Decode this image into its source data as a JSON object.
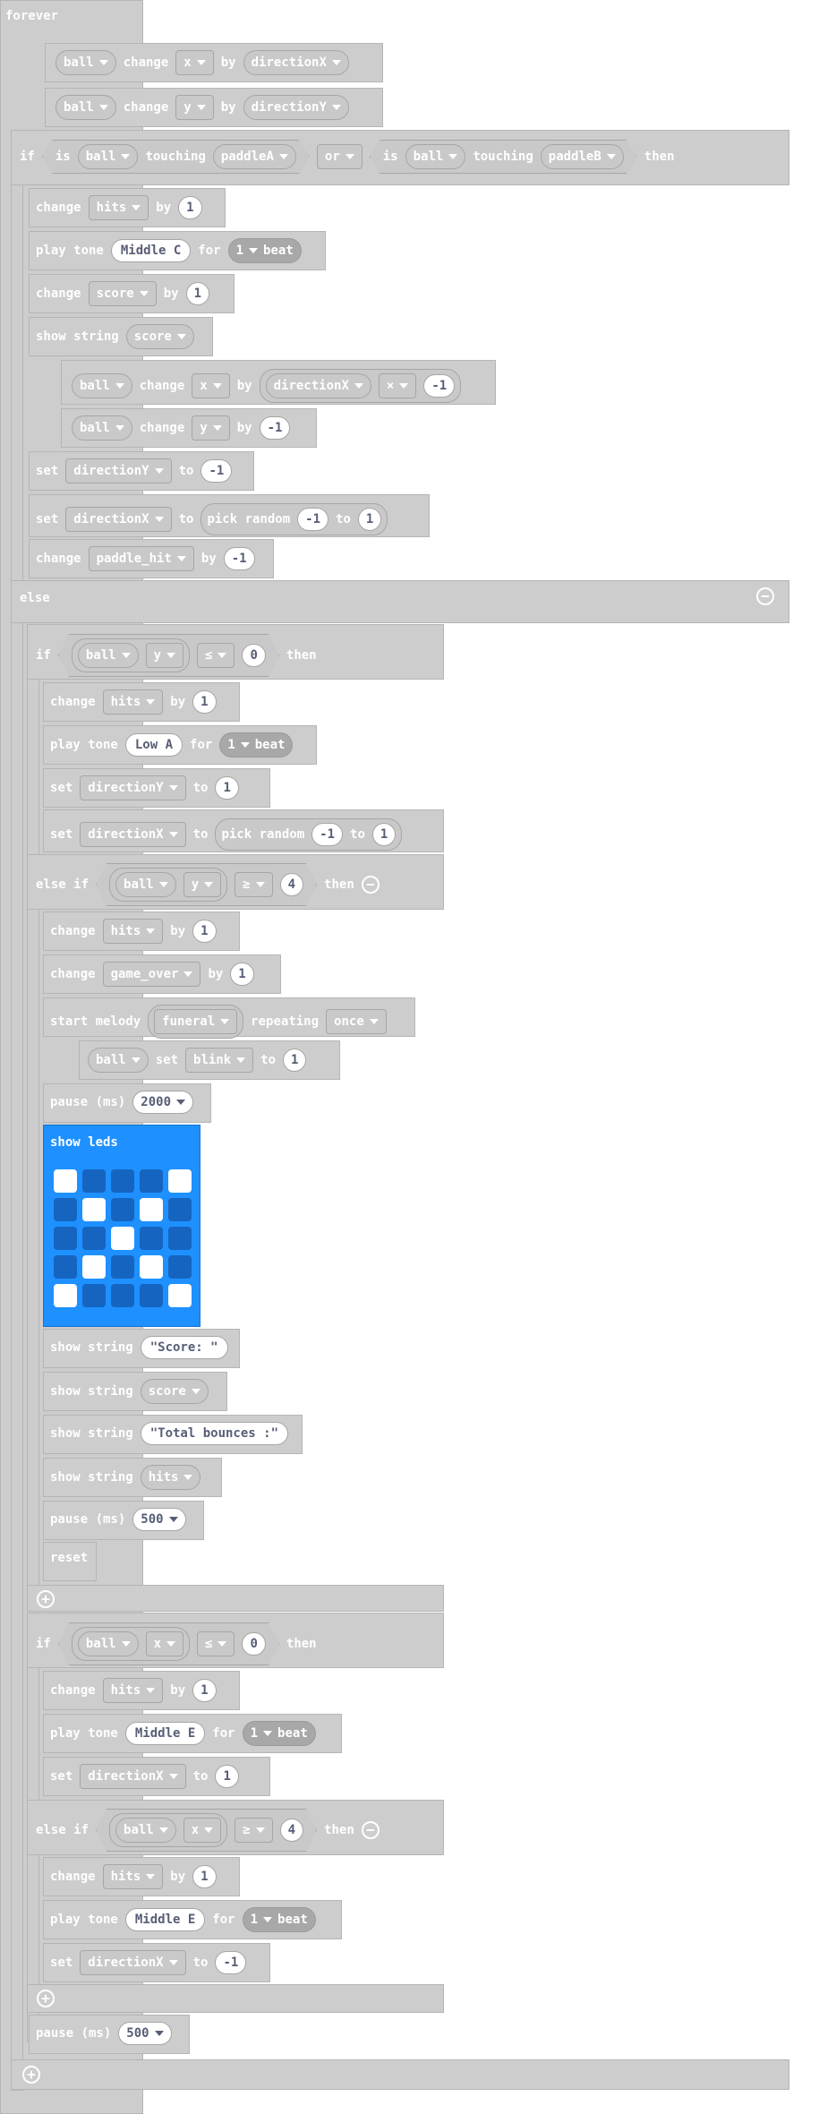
{
  "blocks": [
    {
      "w": "forever"
    },
    {
      "w": "ball"
    },
    {
      "w": "change"
    },
    {
      "w": "x"
    },
    {
      "w": "by"
    },
    {
      "w": "directionX"
    },
    {
      "w": "ball"
    },
    {
      "w": "change"
    },
    {
      "w": "y"
    },
    {
      "w": "by"
    },
    {
      "w": "directionY"
    },
    {
      "w": "if"
    },
    {
      "w": "is"
    },
    {
      "w": "ball"
    },
    {
      "w": "touching"
    },
    {
      "w": "paddleA"
    },
    {
      "w": "or"
    },
    {
      "w": "is"
    },
    {
      "w": "ball"
    },
    {
      "w": "touching"
    },
    {
      "w": "paddleB"
    },
    {
      "w": "then"
    },
    {
      "w": "change"
    },
    {
      "w": "hits"
    },
    {
      "w": "by"
    },
    {
      "w": "1"
    },
    {
      "w": "play tone"
    },
    {
      "w": "Middle C"
    },
    {
      "w": "for"
    },
    {
      "w": "1"
    },
    {
      "w": "beat"
    },
    {
      "w": "change"
    },
    {
      "w": "score"
    },
    {
      "w": "by"
    },
    {
      "w": "1"
    },
    {
      "w": "show string"
    },
    {
      "w": "score"
    },
    {
      "w": "ball"
    },
    {
      "w": "change"
    },
    {
      "w": "x"
    },
    {
      "w": "by"
    },
    {
      "w": "directionX"
    },
    {
      "w": "×"
    },
    {
      "w": "-1"
    },
    {
      "w": "ball"
    },
    {
      "w": "change"
    },
    {
      "w": "y"
    },
    {
      "w": "by"
    },
    {
      "w": "-1"
    },
    {
      "w": "set"
    },
    {
      "w": "directionY"
    },
    {
      "w": "to"
    },
    {
      "w": "-1"
    },
    {
      "w": "set"
    },
    {
      "w": "directionX"
    },
    {
      "w": "to"
    },
    {
      "w": "pick random"
    },
    {
      "w": "-1"
    },
    {
      "w": "to"
    },
    {
      "w": "1"
    },
    {
      "w": "change"
    },
    {
      "w": "paddle_hit"
    },
    {
      "w": "by"
    },
    {
      "w": "-1"
    },
    {
      "w": "else"
    },
    {
      "w": "if"
    },
    {
      "w": "ball"
    },
    {
      "w": "y"
    },
    {
      "w": "≤"
    },
    {
      "w": "0"
    },
    {
      "w": "then"
    },
    {
      "w": "change"
    },
    {
      "w": "hits"
    },
    {
      "w": "by"
    },
    {
      "w": "1"
    },
    {
      "w": "play tone"
    },
    {
      "w": "Low A"
    },
    {
      "w": "for"
    },
    {
      "w": "1"
    },
    {
      "w": "beat"
    },
    {
      "w": "set"
    },
    {
      "w": "directionY"
    },
    {
      "w": "to"
    },
    {
      "w": "1"
    },
    {
      "w": "set"
    },
    {
      "w": "directionX"
    },
    {
      "w": "to"
    },
    {
      "w": "pick random"
    },
    {
      "w": "-1"
    },
    {
      "w": "to"
    },
    {
      "w": "1"
    },
    {
      "w": "else if"
    },
    {
      "w": "ball"
    },
    {
      "w": "y"
    },
    {
      "w": "≥"
    },
    {
      "w": "4"
    },
    {
      "w": "then"
    },
    {
      "w": "change"
    },
    {
      "w": "hits"
    },
    {
      "w": "by"
    },
    {
      "w": "1"
    },
    {
      "w": "change"
    },
    {
      "w": "game_over"
    },
    {
      "w": "by"
    },
    {
      "w": "1"
    },
    {
      "w": "start melody"
    },
    {
      "w": "funeral"
    },
    {
      "w": "repeating"
    },
    {
      "w": "once"
    },
    {
      "w": "ball"
    },
    {
      "w": "set"
    },
    {
      "w": "blink"
    },
    {
      "w": "to"
    },
    {
      "w": "1"
    },
    {
      "w": "pause (ms)"
    },
    {
      "w": "2000"
    },
    {
      "w": "show leds"
    },
    {
      "w": "show string"
    },
    {
      "w": "\"Score: \""
    },
    {
      "w": "show string"
    },
    {
      "w": "score"
    },
    {
      "w": "show string"
    },
    {
      "w": "\"Total bounces :\""
    },
    {
      "w": "show string"
    },
    {
      "w": "hits"
    },
    {
      "w": "pause (ms)"
    },
    {
      "w": "500"
    },
    {
      "w": "reset"
    },
    {
      "w": "if"
    },
    {
      "w": "ball"
    },
    {
      "w": "x"
    },
    {
      "w": "≤"
    },
    {
      "w": "0"
    },
    {
      "w": "then"
    },
    {
      "w": "change"
    },
    {
      "w": "hits"
    },
    {
      "w": "by"
    },
    {
      "w": "1"
    },
    {
      "w": "play tone"
    },
    {
      "w": "Middle E"
    },
    {
      "w": "for"
    },
    {
      "w": "1"
    },
    {
      "w": "beat"
    },
    {
      "w": "set"
    },
    {
      "w": "directionX"
    },
    {
      "w": "to"
    },
    {
      "w": "1"
    },
    {
      "w": "else if"
    },
    {
      "w": "ball"
    },
    {
      "w": "x"
    },
    {
      "w": "≥"
    },
    {
      "w": "4"
    },
    {
      "w": "then"
    },
    {
      "w": "change"
    },
    {
      "w": "hits"
    },
    {
      "w": "by"
    },
    {
      "w": "1"
    },
    {
      "w": "play tone"
    },
    {
      "w": "Middle E"
    },
    {
      "w": "for"
    },
    {
      "w": "1"
    },
    {
      "w": "beat"
    },
    {
      "w": "set"
    },
    {
      "w": "directionX"
    },
    {
      "w": "to"
    },
    {
      "w": "-1"
    },
    {
      "w": "pause (ms)"
    },
    {
      "w": "500"
    }
  ],
  "leds": [
    true,
    false,
    false,
    false,
    true,
    false,
    true,
    false,
    true,
    false,
    false,
    false,
    true,
    false,
    false,
    false,
    true,
    false,
    true,
    false,
    true,
    false,
    false,
    false,
    true
  ],
  "icons": {
    "collapse": "minus-circle-icon",
    "add": "plus-circle-icon",
    "dropdown": "caret-down-icon"
  },
  "colors": {
    "block": "#cdcdcd",
    "leds_block": "#1e90ff",
    "led_on": "#ffffff",
    "led_off": "#1565c0"
  }
}
